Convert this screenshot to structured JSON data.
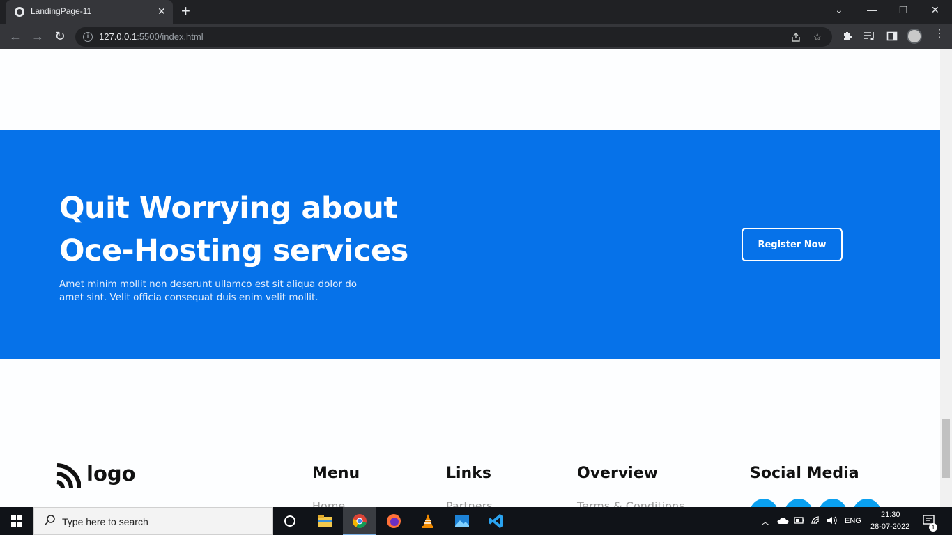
{
  "browser": {
    "tab_title": "LandingPage-11",
    "tab_close": "✕",
    "new_tab": "+",
    "url_host": "127.0.0.1",
    "url_rest": ":5500/index.html",
    "controls": {
      "chevron": "⌄",
      "minimize": "—",
      "restore": "❐",
      "close": "✕"
    },
    "nav": {
      "back": "←",
      "forward": "→",
      "reload": "↻"
    }
  },
  "cta": {
    "heading": "Quit Worrying about Oce-Hosting services",
    "subtext": "Amet minim mollit non deserunt ullamco est sit aliqua dolor do amet sint. Velit officia consequat duis enim velit mollit.",
    "button_label": "Register Now",
    "background_color": "#0672e9"
  },
  "footer": {
    "logo_text": "logo",
    "columns": [
      {
        "heading": "Menu",
        "first_link": "Home"
      },
      {
        "heading": "Links",
        "first_link": "Partners"
      },
      {
        "heading": "Overview",
        "first_link": "Terms & Conditions"
      },
      {
        "heading": "Social Media"
      }
    ],
    "social_color": "#0aa0f0"
  },
  "taskbar": {
    "search_placeholder": "Type here to search",
    "language": "ENG",
    "time": "21:30",
    "date": "28-07-2022",
    "notification_count": "1"
  }
}
